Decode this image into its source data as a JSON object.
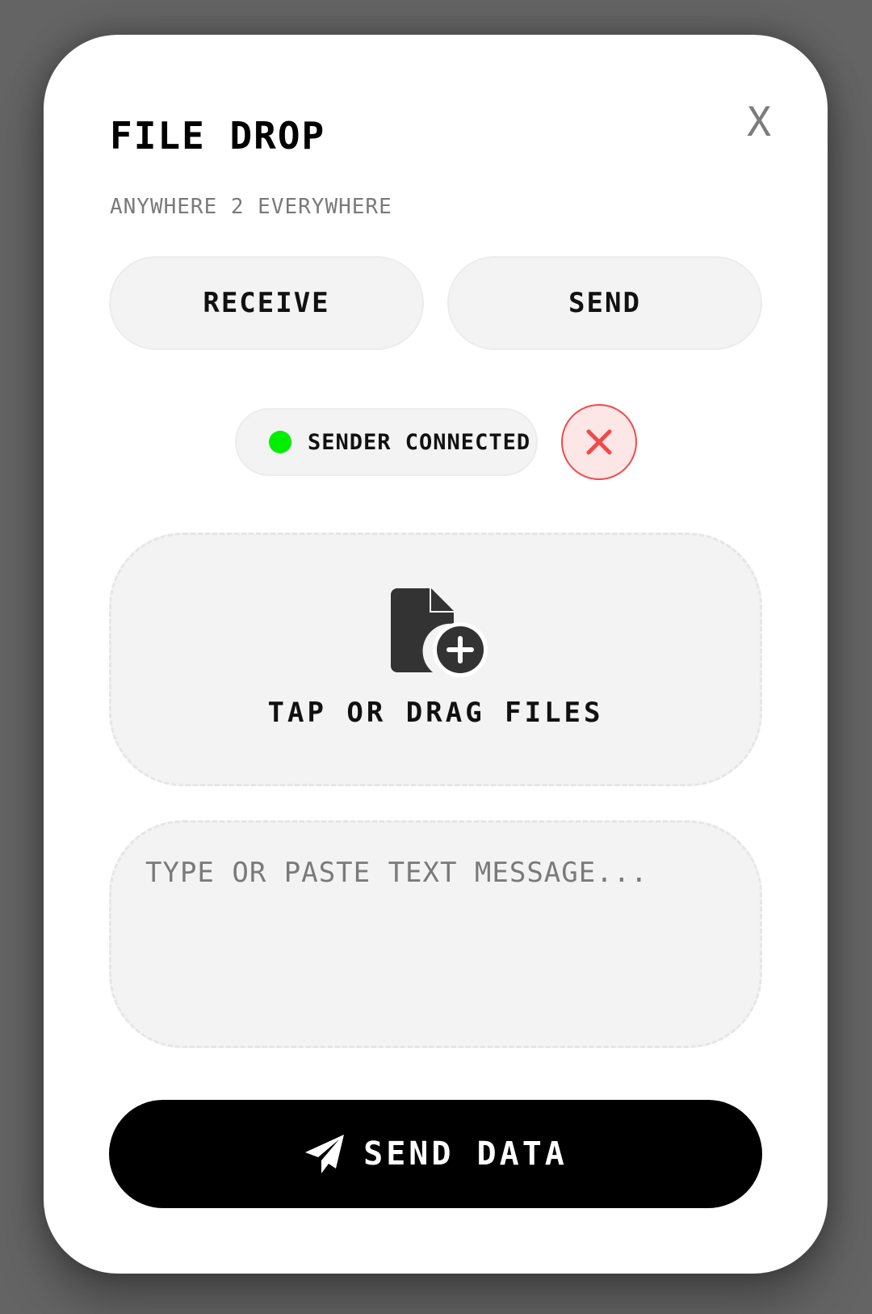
{
  "header": {
    "title": "FILE DROP",
    "subtitle": "ANYWHERE 2 EVERYWHERE",
    "close_label": "X"
  },
  "modes": {
    "receive_label": "RECEIVE",
    "send_label": "SEND"
  },
  "status": {
    "text": "SENDER CONNECTED",
    "dot_color": "#00ee00",
    "disconnect_icon": "close-icon",
    "disconnect_color": "#ef4a4a"
  },
  "drop_zone": {
    "icon": "file-add-icon",
    "label": "TAP OR DRAG FILES"
  },
  "message": {
    "placeholder": "TYPE OR PASTE TEXT MESSAGE...",
    "value": ""
  },
  "send_button": {
    "icon": "paper-plane-icon",
    "label": "SEND DATA"
  },
  "colors": {
    "backdrop": "#646464",
    "card": "#ffffff",
    "surface": "#f3f3f3",
    "primary": "#000000"
  }
}
